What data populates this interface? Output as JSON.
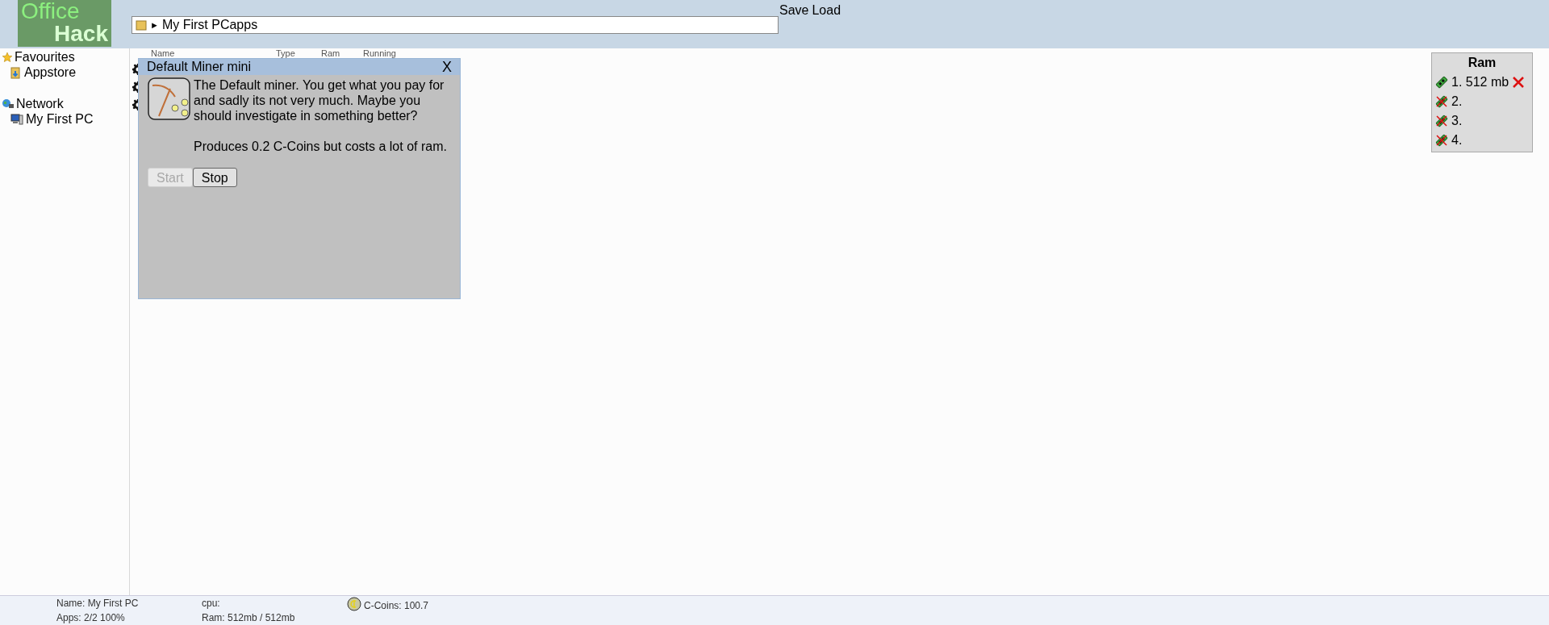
{
  "header": {
    "logo": [
      "Office",
      "Hack"
    ],
    "path": {
      "separator": "►",
      "text": "My First PCapps"
    },
    "menu": [
      "Save",
      "Load"
    ]
  },
  "sidebar": {
    "groups": [
      {
        "label": "Favourites",
        "kind": "star",
        "children": [
          {
            "label": "Appstore",
            "kind": "store"
          }
        ]
      },
      {
        "label": "Network",
        "kind": "globe",
        "children": [
          {
            "label": "My First PC",
            "kind": "computer"
          }
        ]
      }
    ]
  },
  "apps_table": {
    "columns": [
      "Name",
      "Type",
      "Ram",
      "Running"
    ],
    "rows": [
      {
        "kind": "gear"
      },
      {
        "kind": "gear"
      },
      {
        "kind": "gear"
      }
    ]
  },
  "dialog": {
    "title": "Default Miner mini",
    "close": "X",
    "description": "The Default miner. You get what you pay for and sadly its not very much. Maybe you should investigate in something better?",
    "production": "Produces 0.2 C-Coins but costs a lot of ram.",
    "buttons": [
      {
        "label": "Start",
        "disabled": true
      },
      {
        "label": "Stop",
        "disabled": false
      }
    ]
  },
  "ram_panel": {
    "title": "Ram",
    "slots": [
      {
        "label": "1. 512 mb",
        "filled": true
      },
      {
        "label": "2.",
        "filled": false
      },
      {
        "label": "3.",
        "filled": false
      },
      {
        "label": "4.",
        "filled": false
      }
    ]
  },
  "status_bar": {
    "name": "Name: My First PC",
    "apps": "Apps: 2/2 100%",
    "cpu": "cpu:",
    "ram": "Ram: 512mb / 512mb",
    "coins": "C-Coins: 100.7"
  }
}
